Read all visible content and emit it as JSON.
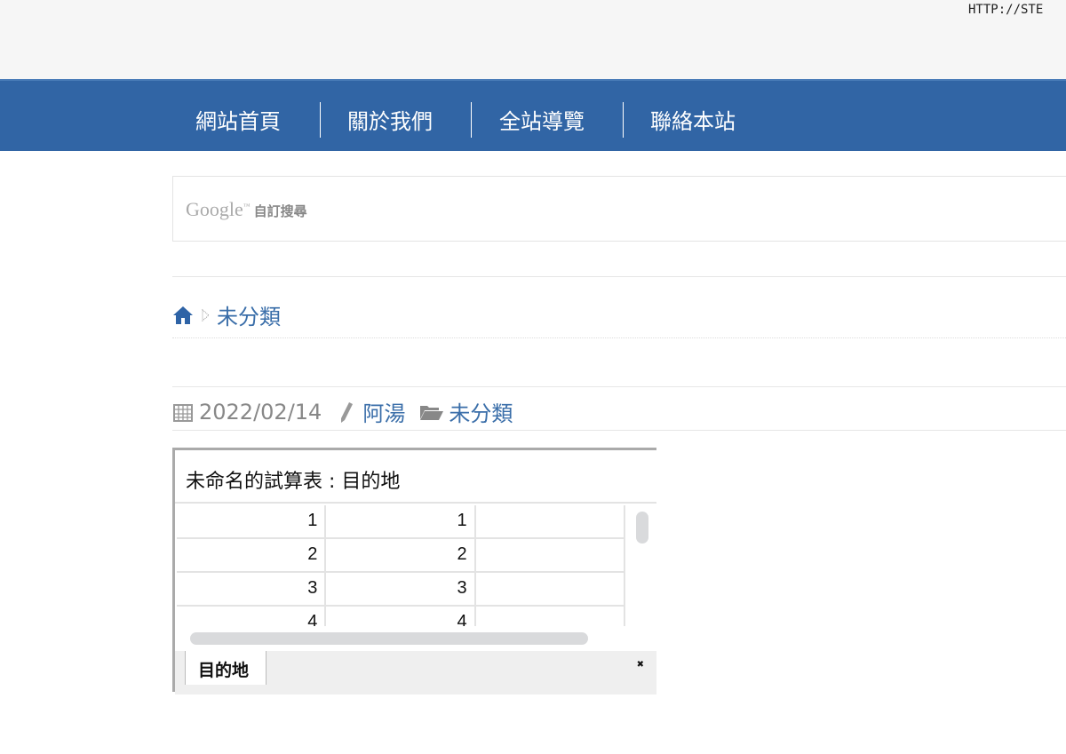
{
  "header": {
    "url_text": "HTTP://STE"
  },
  "nav": {
    "items": [
      "網站首頁",
      "關於我們",
      "全站導覽",
      "聯絡本站"
    ]
  },
  "search": {
    "brand": "Google",
    "tm": "™",
    "label": "自訂搜尋"
  },
  "breadcrumb": {
    "category": "未分類"
  },
  "post_meta": {
    "date": "2022/02/14",
    "author": "阿湯",
    "category": "未分類"
  },
  "spreadsheet": {
    "title": "未命名的試算表 : 目的地",
    "rows": [
      [
        "1",
        "1",
        ""
      ],
      [
        "2",
        "2",
        ""
      ],
      [
        "3",
        "3",
        ""
      ],
      [
        "4",
        "4",
        ""
      ]
    ],
    "sheet_tab": "目的地",
    "tab_icon": "expand-icon"
  },
  "colors": {
    "nav_bg": "#3165a5",
    "link": "#3a6ea9"
  }
}
